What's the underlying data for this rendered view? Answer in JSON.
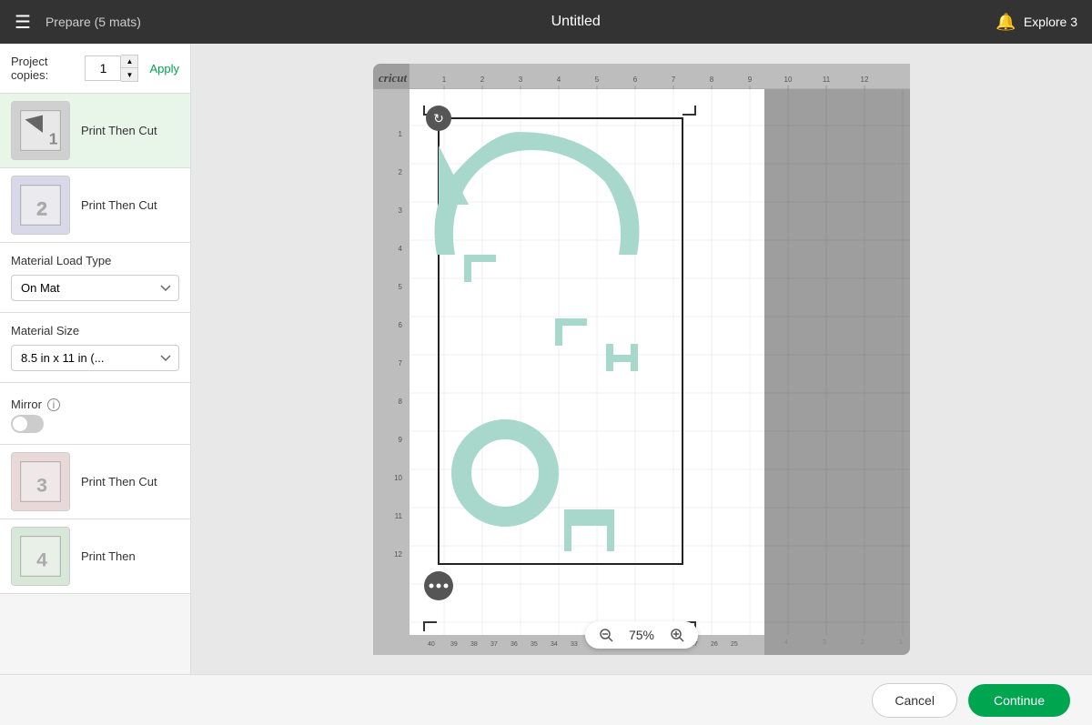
{
  "header": {
    "menu_label": "☰",
    "title": "Untitled",
    "prepare_label": "Prepare (5 mats)",
    "bell_icon": "🔔",
    "machine": "Explore 3"
  },
  "sidebar": {
    "project_copies_label": "Project copies:",
    "copies_value": "1",
    "apply_label": "Apply",
    "mat_items": [
      {
        "id": 1,
        "label": "Print Then Cut",
        "active": true
      },
      {
        "id": 2,
        "label": "Print Then Cut",
        "active": false
      },
      {
        "id": 3,
        "label": "Print Then Cut",
        "active": false
      },
      {
        "id": 4,
        "label": "Print Then",
        "active": false
      }
    ],
    "material_load_type_label": "Material Load Type",
    "material_load_type_value": "On Mat",
    "material_size_label": "Material Size",
    "material_size_value": "8.5 in x 11 in (...",
    "mirror_label": "Mirror",
    "mirror_on": false
  },
  "canvas": {
    "cricut_logo": "cricut",
    "zoom_level": "75%",
    "zoom_in": "+",
    "zoom_out": "−"
  },
  "footer": {
    "cancel_label": "Cancel",
    "continue_label": "Continue"
  }
}
